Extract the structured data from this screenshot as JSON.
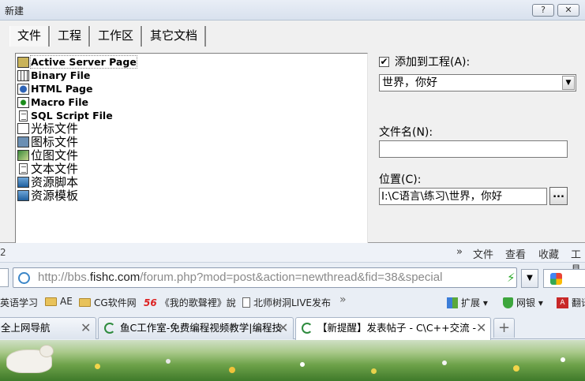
{
  "dialog": {
    "title": "新建",
    "help_label": "?",
    "close_label": "✕",
    "tabs": [
      "文件",
      "工程",
      "工作区",
      "其它文档"
    ],
    "file_types": [
      {
        "label": "Active Server Page",
        "icon": "asp-file-icon"
      },
      {
        "label": "Binary File",
        "icon": "binary-file-icon"
      },
      {
        "label": "HTML Page",
        "icon": "html-file-icon"
      },
      {
        "label": "Macro File",
        "icon": "macro-file-icon"
      },
      {
        "label": "SQL Script File",
        "icon": "sql-file-icon"
      },
      {
        "label": "光标文件",
        "icon": "cursor-file-icon"
      },
      {
        "label": "图标文件",
        "icon": "icon-file-icon"
      },
      {
        "label": "位图文件",
        "icon": "bitmap-file-icon"
      },
      {
        "label": "文本文件",
        "icon": "text-file-icon"
      },
      {
        "label": "资源脚本",
        "icon": "resource-script-icon"
      },
      {
        "label": "资源模板",
        "icon": "resource-template-icon"
      }
    ],
    "add_to_project": {
      "checked": true,
      "check_mark": "✔",
      "label": "添加到工程(A):"
    },
    "project_value": "世界，你好",
    "filename_label": "文件名(N):",
    "filename_value": "",
    "location_label": "位置(C):",
    "location_value": "I:\\C语言\\练习\\世界，你好",
    "browse_label": "..."
  },
  "browser": {
    "menubar": {
      "left_fragment": "2",
      "more": "»",
      "items": [
        "文件",
        "查看",
        "收藏",
        "工具"
      ]
    },
    "address": {
      "prefix": "http://bbs.",
      "host": "fishc.com",
      "path": "/forum.php?mod=post&action=newthread&fid=38&special",
      "dropdown": "▼"
    },
    "favorites": [
      {
        "label": "英语学习",
        "icon": "none"
      },
      {
        "label": "AE",
        "icon": "folder-icon"
      },
      {
        "label": "CG软件网",
        "icon": "folder-icon"
      },
      {
        "label": "《我的歌聲裡》說",
        "icon": "56-icon",
        "badge": "56"
      },
      {
        "label": "北师树洞LIVE发布",
        "icon": "page-icon"
      }
    ],
    "favorites_more": "»",
    "toolbar_right": [
      {
        "label": "扩展",
        "icon": "extensions-icon"
      },
      {
        "label": "网银",
        "icon": "shield-icon"
      },
      {
        "label": "翻译",
        "icon": "translate-icon",
        "icon_text": "A"
      }
    ],
    "tabs": [
      {
        "label": "全上网导航",
        "active": false
      },
      {
        "label": "鱼C工作室-免费编程视频教学|编程技",
        "active": false
      },
      {
        "label": "【新提醒】发表帖子 - C\\C++交流 -",
        "active": true
      }
    ],
    "tab_close": "✕",
    "new_tab": "+"
  }
}
